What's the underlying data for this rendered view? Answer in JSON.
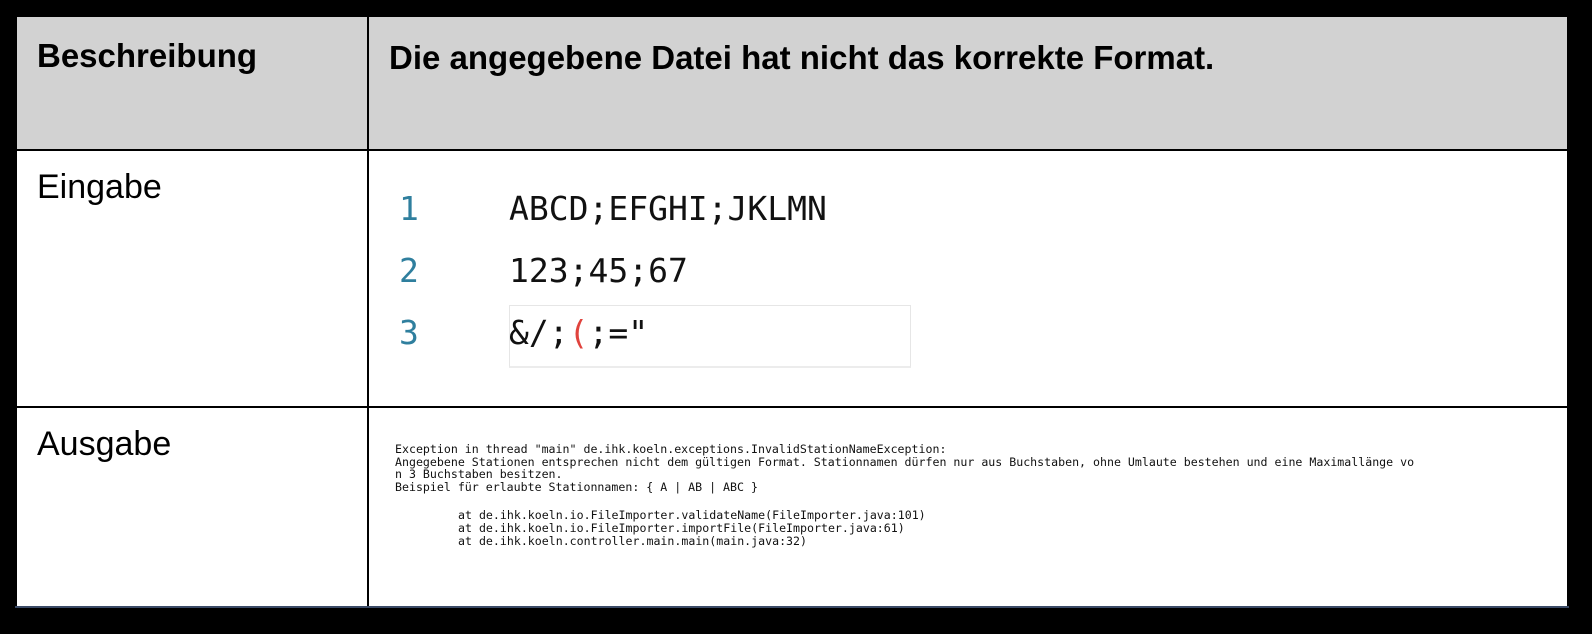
{
  "header": {
    "label": "Beschreibung",
    "title": "Die angegebene Datei hat nicht das korrekte Format."
  },
  "input": {
    "label": "Eingabe",
    "lines": [
      {
        "number": "1",
        "text": "ABCD;EFGHI;JKLMN"
      },
      {
        "number": "2",
        "text": "123;45;67"
      },
      {
        "number": "3",
        "text_a": "&/;",
        "text_b": "(",
        "text_c": ";=\""
      }
    ],
    "bracket_color": "#e0433d",
    "line_number_color": "#2f7f9e"
  },
  "output": {
    "label": "Ausgabe",
    "lines": [
      "Exception in thread \"main\" de.ihk.koeln.exceptions.InvalidStationNameException:",
      "Angegebene Stationen entsprechen nicht dem gültigen Format. Stationnamen dürfen nur aus Buchstaben, ohne Umlaute bestehen und eine Maximallänge vo",
      "n 3 Buchstaben besitzen.",
      "Beispiel für erlaubte Stationnamen: { A | AB | ABC }"
    ],
    "stack": [
      "at de.ihk.koeln.io.FileImporter.validateName(FileImporter.java:101)",
      "at de.ihk.koeln.io.FileImporter.importFile(FileImporter.java:61)",
      "at de.ihk.koeln.controller.main.main(main.java:32)"
    ]
  }
}
